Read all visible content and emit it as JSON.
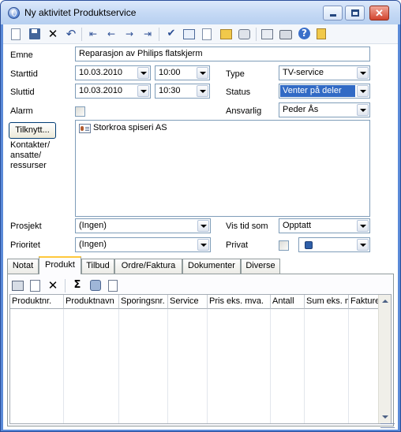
{
  "window": {
    "title": "Ny aktivitet Produktservice",
    "close_glyph": "✕"
  },
  "toolbar": {
    "icons": [
      "new-document-icon",
      "save-icon",
      "delete-icon",
      "undo-icon",
      "first-record-icon",
      "previous-record-icon",
      "next-record-icon",
      "last-record-icon",
      "checkmark-icon",
      "preview-icon",
      "copy-icon",
      "attach-icon",
      "print-preview-icon",
      "properties-icon",
      "print-icon",
      "help-icon",
      "exit-icon"
    ],
    "delete_glyph": "✕",
    "undo_glyph": "↶",
    "first_glyph": "⇤",
    "prev_glyph": "←",
    "next_glyph": "→",
    "last_glyph": "⇥",
    "check_glyph": "✔",
    "help_glyph": "?"
  },
  "form": {
    "emne_label": "Emne",
    "emne_value": "Reparasjon av Philips flatskjerm",
    "starttid_label": "Starttid",
    "start_date": "10.03.2010",
    "start_time": "10:00",
    "sluttid_label": "Sluttid",
    "end_date": "10.03.2010",
    "end_time": "10:30",
    "type_label": "Type",
    "type_value": "TV-service",
    "status_label": "Status",
    "status_value": "Venter på deler",
    "alarm_label": "Alarm",
    "ansvarlig_label": "Ansvarlig",
    "ansvarlig_value": "Peder Ås",
    "tilknytt_button": "Tilknytt...",
    "contacts_label_1": "Kontakter/",
    "contacts_label_2": "ansatte/",
    "contacts_label_3": "ressurser",
    "contacts": [
      "Storkroa spiseri AS"
    ],
    "prosjekt_label": "Prosjekt",
    "prosjekt_value": "(Ingen)",
    "prioritet_label": "Prioritet",
    "prioritet_value": "(Ingen)",
    "vis_tid_label": "Vis tid som",
    "vis_tid_value": "Opptatt",
    "privat_label": "Privat",
    "color_value": "#2f5fa8"
  },
  "tabs": [
    "Notat",
    "Produkt",
    "Tilbud",
    "Ordre/Faktura",
    "Dokumenter",
    "Diverse"
  ],
  "active_tab": "Produkt",
  "product_toolbar": {
    "icons": [
      "add-product-icon",
      "edit-icon",
      "delete-icon",
      "sum-icon",
      "stock-icon",
      "document-icon"
    ],
    "delete_glyph": "✕",
    "sum_glyph": "Σ"
  },
  "grid": {
    "columns": [
      "Produktnr.",
      "Produktnavn",
      "Sporingsnr.",
      "Service",
      "Pris eks. mva.",
      "Antall",
      "Sum eks. mva.",
      "Fakturert"
    ],
    "rows": []
  }
}
